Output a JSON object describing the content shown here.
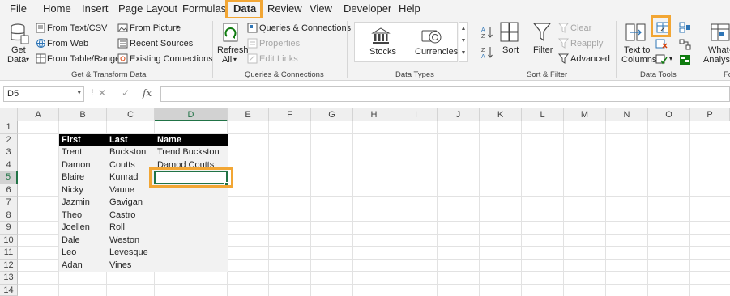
{
  "menu": {
    "tabs": [
      "File",
      "Home",
      "Insert",
      "Page Layout",
      "Formulas",
      "Data",
      "Review",
      "View",
      "Developer",
      "Help"
    ],
    "active": "Data"
  },
  "ribbon": {
    "get_transform": {
      "get_data_line1": "Get",
      "get_data_line2": "Data",
      "from_text_csv": "From Text/CSV",
      "from_web": "From Web",
      "from_table_range": "From Table/Range",
      "from_picture": "From Picture",
      "recent_sources": "Recent Sources",
      "existing_connections": "Existing Connections",
      "label": "Get & Transform Data"
    },
    "queries": {
      "refresh_line1": "Refresh",
      "refresh_line2": "All",
      "queries_connections": "Queries & Connections",
      "properties": "Properties",
      "edit_links": "Edit Links",
      "label": "Queries & Connections"
    },
    "data_types": {
      "stocks": "Stocks",
      "currencies": "Currencies",
      "label": "Data Types"
    },
    "sort_filter": {
      "sort": "Sort",
      "filter": "Filter",
      "clear": "Clear",
      "reapply": "Reapply",
      "advanced": "Advanced",
      "label": "Sort & Filter"
    },
    "data_tools": {
      "text_to_line1": "Text to",
      "text_to_line2": "Columns",
      "label": "Data Tools"
    },
    "forecast": {
      "whatif_line1": "What-",
      "whatif_line2": "Analysis",
      "label": "Fo"
    }
  },
  "formula_bar": {
    "name_box": "D5",
    "fx": "fx",
    "cancel": "✕",
    "enter": "✓",
    "value": ""
  },
  "sheet": {
    "columns": [
      "A",
      "B",
      "C",
      "D",
      "E",
      "F",
      "G",
      "H",
      "I",
      "J",
      "K",
      "L",
      "M",
      "N",
      "O",
      "P"
    ],
    "rows": [
      "1",
      "2",
      "3",
      "4",
      "5",
      "6",
      "7",
      "8",
      "9",
      "10",
      "11",
      "12",
      "13",
      "14"
    ],
    "selected_cell": "D5",
    "header": {
      "first": "First",
      "last": "Last",
      "name": "Name"
    },
    "data": [
      {
        "first": "Trent",
        "last": "Buckston",
        "name": "Trend Buckston"
      },
      {
        "first": "Damon",
        "last": "Coutts",
        "name": "Damod Coutts"
      },
      {
        "first": "Blaire",
        "last": "Kunrad",
        "name": ""
      },
      {
        "first": "Nicky",
        "last": "Vaune",
        "name": ""
      },
      {
        "first": "Jazmin",
        "last": "Gavigan",
        "name": ""
      },
      {
        "first": "Theo",
        "last": "Castro",
        "name": ""
      },
      {
        "first": "Joellen",
        "last": "Roll",
        "name": ""
      },
      {
        "first": "Dale",
        "last": "Weston",
        "name": ""
      },
      {
        "first": "Leo",
        "last": "Levesque",
        "name": ""
      },
      {
        "first": "Adan",
        "last": "Vines",
        "name": ""
      }
    ]
  },
  "colors": {
    "highlight": "#f2a634",
    "excel_green": "#217346",
    "header_fill": "#000000",
    "band_fill": "#f2f2f2"
  },
  "icons": {
    "get_data": "database-icon",
    "stocks": "bank-icon",
    "currencies": "coins-icon",
    "sort": "sort-az-icon",
    "filter": "funnel-icon",
    "flash_fill": "flash-fill-icon",
    "text_to_columns": "text-to-columns-icon"
  }
}
